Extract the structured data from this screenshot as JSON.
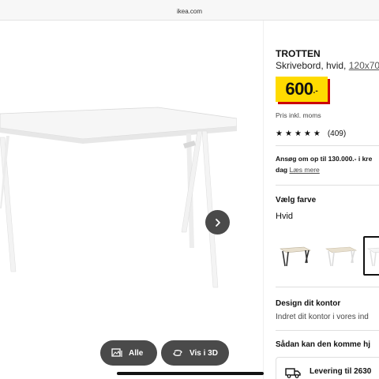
{
  "browser": {
    "url": "ikea.com"
  },
  "gallery": {
    "buttons": {
      "alle": "Alle",
      "vis3d": "Vis i 3D"
    }
  },
  "product": {
    "name": "TROTTEN",
    "description": "Skrivebord, hvid,",
    "size": "120x70",
    "price": "600",
    "price_suffix": ".-",
    "vat_note": "Pris inkl. moms",
    "rating": 5,
    "review_count": "(409)",
    "loan_line1": "Ansøg om op til 130.000.- i kre",
    "loan_line2": "dag",
    "loan_link": "Læs mere",
    "color_title": "Vælg farve",
    "color_value": "Hvid",
    "swatches": [
      "beige/anthracite",
      "beige/white",
      "white"
    ],
    "selected_swatch": "white",
    "design_title": "Design dit kontor",
    "design_text": "Indret dit kontor i vores ind",
    "delivery_title": "Sådan kan den komme hj",
    "delivery_text": "Levering til 2630"
  },
  "colors": {
    "price_bg": "#ffdb00",
    "price_shadow": "#cc0008",
    "button_bg": "#4a4a4a"
  }
}
